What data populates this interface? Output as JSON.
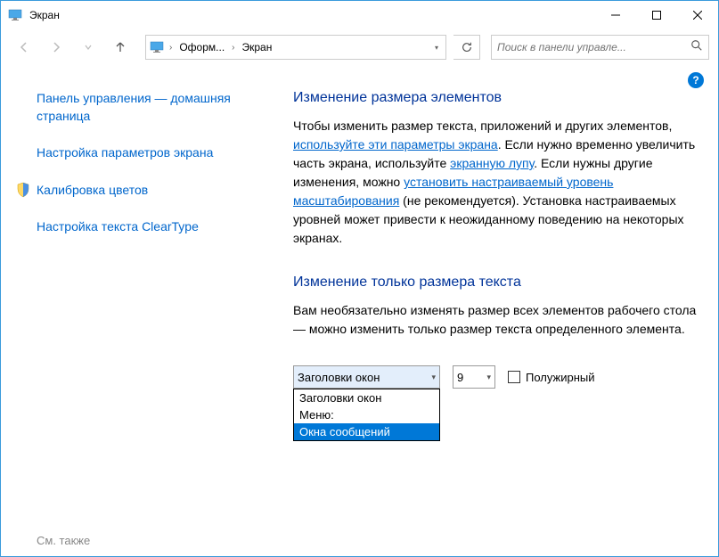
{
  "window": {
    "title": "Экран"
  },
  "nav": {
    "crumb1": "Оформ...",
    "crumb2": "Экран",
    "search_placeholder": "Поиск в панели управле..."
  },
  "sidebar": {
    "home": "Панель управления — домашняя страница",
    "params": "Настройка параметров экрана",
    "calib": "Калибровка цветов",
    "cleartype": "Настройка текста ClearType",
    "see_also": "См. также"
  },
  "main": {
    "heading1": "Изменение размера элементов",
    "p1a": "Чтобы изменить размер текста, приложений и других элементов, ",
    "p1link1": "используйте эти параметры экрана",
    "p1b": ". Если нужно временно увеличить часть экрана, используйте ",
    "p1link2": "экранную лупу",
    "p1c": ". Если нужны другие изменения, можно ",
    "p1link3": "установить настраиваемый уровень масштабирования",
    "p1d": " (не рекомендуется). Установка настраиваемых уровней может привести к неожиданному поведению на некоторых экранах.",
    "heading2": "Изменение только размера текста",
    "p2": "Вам необязательно изменять размер всех элементов рабочего стола — можно изменить только размер текста определенного элемента.",
    "select_element": "Заголовки окон",
    "select_size": "9",
    "bold_label": "Полужирный",
    "dropdown": {
      "opt1": "Заголовки окон",
      "opt2": "Меню:",
      "opt3": "Окна сообщений"
    }
  }
}
